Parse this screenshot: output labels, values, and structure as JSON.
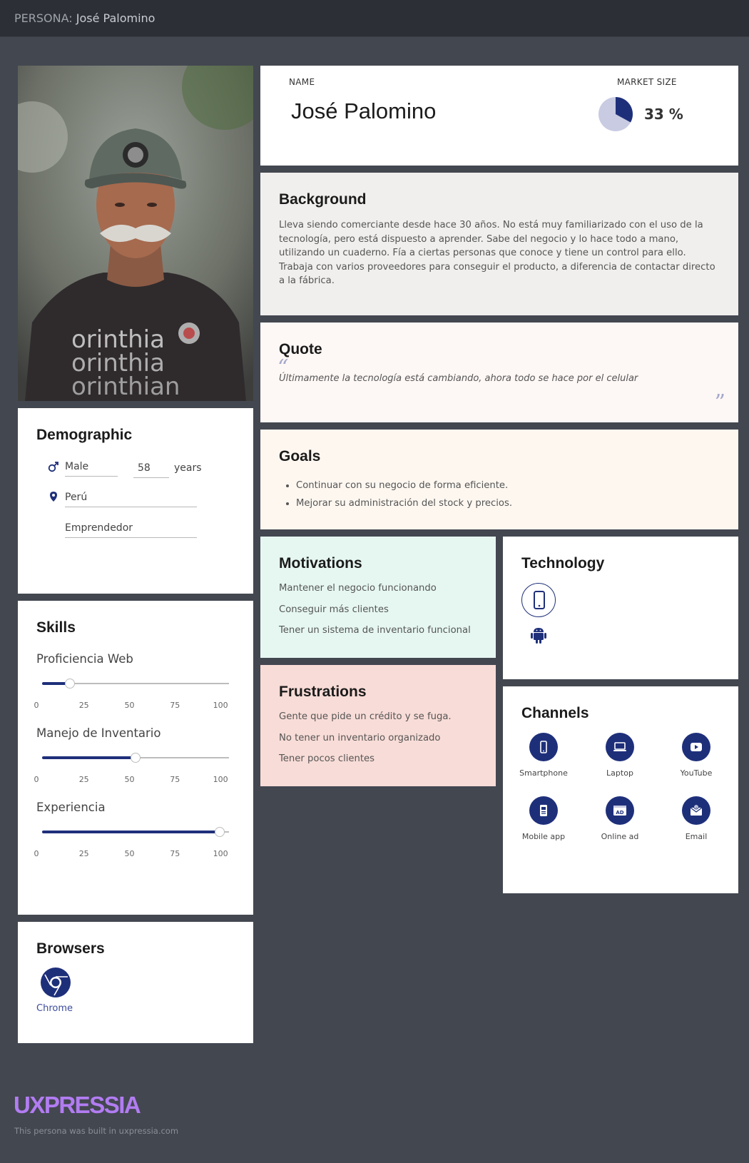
{
  "header": {
    "label": "PERSONA:",
    "name": "José Palomino"
  },
  "name_card": {
    "name_label": "NAME",
    "name": "José Palomino",
    "market_label": "MARKET SIZE",
    "market_value": "33 %",
    "market_fraction": 0.33
  },
  "background": {
    "title": "Background",
    "text": "Lleva siendo comerciante desde hace 30 años. No está muy familiarizado con el uso de la tecnología, pero está dispuesto a aprender. Sabe del negocio y lo hace todo a mano, utilizando un cuaderno. Fía a ciertas personas que conoce y tiene un control para ello. Trabaja con varios proveedores para conseguir el producto, a diferencia de contactar directo a la fábrica."
  },
  "quote": {
    "title": "Quote",
    "text": "Últimamente la tecnología está cambiando, ahora todo se hace por el celular"
  },
  "goals": {
    "title": "Goals",
    "items": [
      "Continuar con su negocio de forma eficiente.",
      "Mejorar su administración del stock y precios."
    ]
  },
  "motivations": {
    "title": "Motivations",
    "items": [
      "Mantener el negocio funcionando",
      "Conseguir más clientes",
      "Tener un sistema de inventario funcional"
    ]
  },
  "frustrations": {
    "title": "Frustrations",
    "items": [
      "Gente que pide un crédito y se fuga.",
      "No tener un inventario organizado",
      "Tener pocos clientes"
    ]
  },
  "technology": {
    "title": "Technology",
    "icons": [
      "smartphone-icon",
      "android-icon"
    ]
  },
  "channels": {
    "title": "Channels",
    "items": [
      {
        "label": "Smartphone",
        "icon": "smartphone-icon"
      },
      {
        "label": "Laptop",
        "icon": "laptop-icon"
      },
      {
        "label": "YouTube",
        "icon": "youtube-icon"
      },
      {
        "label": "Mobile app",
        "icon": "mobile-app-icon"
      },
      {
        "label": "Online ad",
        "icon": "online-ad-icon"
      },
      {
        "label": "Email",
        "icon": "email-icon"
      }
    ]
  },
  "demographic": {
    "title": "Demographic",
    "gender": "Male",
    "age": "58",
    "age_unit": "years",
    "country": "Perú",
    "occupation": "Emprendedor"
  },
  "skills": {
    "title": "Skills",
    "ticks": [
      "0",
      "25",
      "50",
      "75",
      "100"
    ],
    "items": [
      {
        "label": "Proficiencia Web",
        "value": 15
      },
      {
        "label": "Manejo de Inventario",
        "value": 50
      },
      {
        "label": "Experiencia",
        "value": 95
      }
    ]
  },
  "browsers": {
    "title": "Browsers",
    "items": [
      {
        "label": "Chrome",
        "icon": "chrome-icon"
      }
    ]
  },
  "footer": {
    "logo": "UXPRESSIA",
    "note": "This persona was built in uxpressia.com"
  },
  "colors": {
    "accent": "#1e2f7a",
    "page_bg": "#434750",
    "logo": "#b27cf2"
  }
}
